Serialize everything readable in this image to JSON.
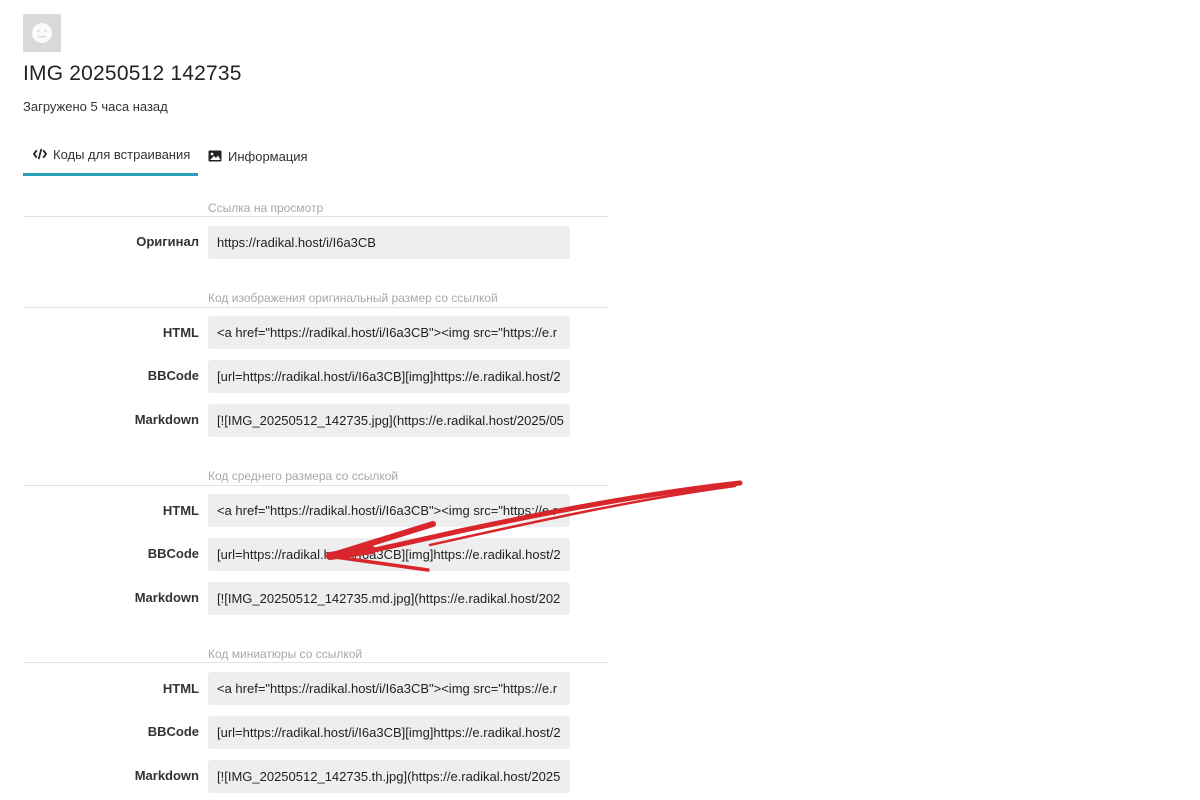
{
  "page": {
    "title": "IMG 20250512 142735",
    "uploaded": "Загружено 5 часа назад"
  },
  "tabs": [
    {
      "label": "Коды для встраивания",
      "icon": "code-icon",
      "active": true
    },
    {
      "label": "Информация",
      "icon": "image-icon",
      "active": false
    }
  ],
  "sections": [
    {
      "caption": "Ссылка на просмотр",
      "rows": [
        {
          "label": "Оригинал",
          "value": "https://radikal.host/i/I6a3CB"
        }
      ]
    },
    {
      "caption": "Код изображения оригинальный размер со ссылкой",
      "rows": [
        {
          "label": "HTML",
          "value": "<a href=\"https://radikal.host/i/I6a3CB\"><img src=\"https://e.r"
        },
        {
          "label": "BBCode",
          "value": "[url=https://radikal.host/i/I6a3CB][img]https://e.radikal.host/2"
        },
        {
          "label": "Markdown",
          "value": "[![IMG_20250512_142735.jpg](https://e.radikal.host/2025/05"
        }
      ]
    },
    {
      "caption": "Код среднего размера со ссылкой",
      "rows": [
        {
          "label": "HTML",
          "value": "<a href=\"https://radikal.host/i/I6a3CB\"><img src=\"https://e.r"
        },
        {
          "label": "BBCode",
          "value": "[url=https://radikal.host/i/I6a3CB][img]https://e.radikal.host/2"
        },
        {
          "label": "Markdown",
          "value": "[![IMG_20250512_142735.md.jpg](https://e.radikal.host/202"
        }
      ]
    },
    {
      "caption": "Код миниатюры со ссылкой",
      "rows": [
        {
          "label": "HTML",
          "value": "<a href=\"https://radikal.host/i/I6a3CB\"><img src=\"https://e.r"
        },
        {
          "label": "BBCode",
          "value": "[url=https://radikal.host/i/I6a3CB][img]https://e.radikal.host/2"
        },
        {
          "label": "Markdown",
          "value": "[![IMG_20250512_142735.th.jpg](https://e.radikal.host/2025"
        }
      ]
    }
  ],
  "colors": {
    "accent": "#2aa0b6",
    "field_bg": "#eeeeee",
    "caption": "#a8a8a8",
    "annotation_arrow": "#d8262c"
  }
}
